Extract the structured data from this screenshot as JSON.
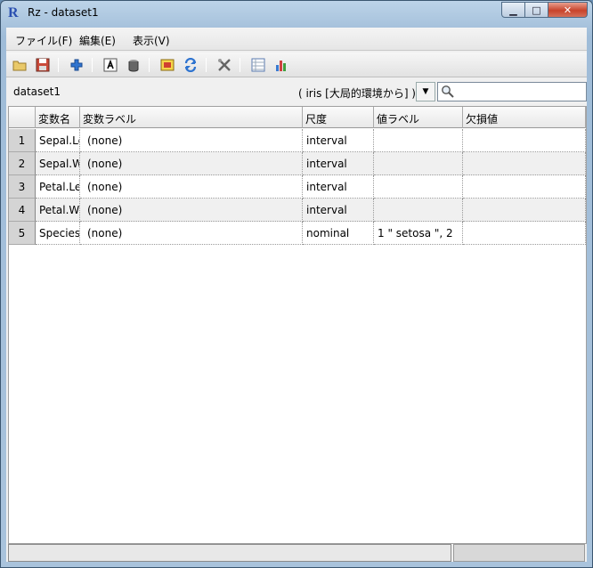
{
  "window": {
    "title": "Rz - dataset1",
    "app_icon_letter": "R",
    "minimize_glyph": "▁",
    "maximize_glyph": "□",
    "close_glyph": "✕"
  },
  "menu": {
    "items": [
      {
        "label": "ファイル(F)"
      },
      {
        "label": "編集(E)"
      },
      {
        "label": "表示(V)"
      }
    ]
  },
  "toolbar": {
    "icons": [
      "open-icon",
      "save-icon",
      "add-variable-icon",
      "text-label-icon",
      "delete-icon",
      "import-icon",
      "refresh-icon",
      "tools-icon",
      "table-icon",
      "chart-icon"
    ]
  },
  "dataset": {
    "name": "dataset1",
    "environment": "( iris [大局的環境から] )",
    "dropdown_glyph": "▼",
    "search_placeholder": ""
  },
  "table": {
    "headers": [
      "",
      "変数名",
      "変数ラベル",
      "尺度",
      "値ラベル",
      "欠損値"
    ],
    "rows": [
      {
        "num": "1",
        "name": "Sepal.Length",
        "label": "(none)",
        "scale": "interval",
        "value_label": "",
        "missing": ""
      },
      {
        "num": "2",
        "name": "Sepal.Width",
        "label": "(none)",
        "scale": "interval",
        "value_label": "",
        "missing": ""
      },
      {
        "num": "3",
        "name": "Petal.Length",
        "label": "(none)",
        "scale": "interval",
        "value_label": "",
        "missing": ""
      },
      {
        "num": "4",
        "name": "Petal.Width",
        "label": "(none)",
        "scale": "interval",
        "value_label": "",
        "missing": ""
      },
      {
        "num": "5",
        "name": "Species",
        "label": "(none)",
        "scale": "nominal",
        "value_label": "1 \" setosa \", 2",
        "missing": ""
      }
    ]
  },
  "colors": {
    "title_bar": "#a9c3dc",
    "close_button": "#c8432b",
    "alt_row": "#f0f0f0",
    "row_header": "#d4d4d4"
  }
}
